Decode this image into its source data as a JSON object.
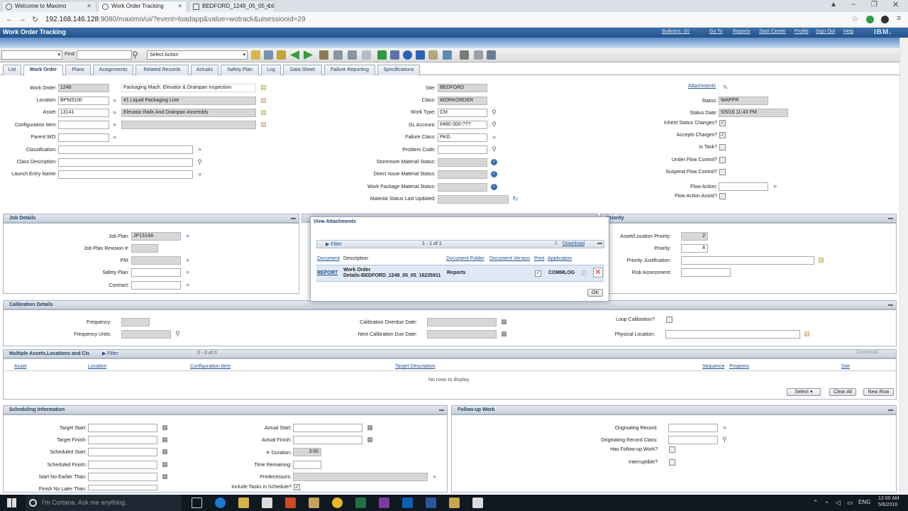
{
  "browser": {
    "tabs": [
      {
        "label": "Welcome to Maximo"
      },
      {
        "label": "Work Order Tracking"
      },
      {
        "label": "BEDFORD_1248_05_05_16"
      }
    ],
    "url_host": "192.168.146.128",
    "url_rest": ":9080/maximo/ui/?event=loadapp&value=wotrack&uisessionid=29"
  },
  "header": {
    "app_title": "Work Order Tracking",
    "links": [
      "Bulletins: (0)",
      "Go To",
      "Reports",
      "Start Center",
      "Profile",
      "Sign Out",
      "Help"
    ],
    "brand": "IBM."
  },
  "toolbar": {
    "find_label": "Find:",
    "select_action": "Select Action"
  },
  "tabs": [
    "List",
    "Work Order",
    "Plans",
    "Assignments",
    "Related Records",
    "Actuals",
    "Safety Plan",
    "Log",
    "Data Sheet",
    "Failure Reporting",
    "Specifications"
  ],
  "wo": {
    "work_order_label": "Work Order:",
    "work_order": "1248",
    "description": "Packaging Mach. Elevator & Drainpan Inspection",
    "location_label": "Location:",
    "location": "BPM3100",
    "location_desc": "#1 Liquid Packaging Line",
    "asset_label": "Asset:",
    "asset": "13141",
    "asset_desc": "Elevator Rails And Drainpan Assembly",
    "config_label": "Configuration Item:",
    "parent_label": "Parent WO:",
    "classification_label": "Classification:",
    "class_desc_label": "Class Description:",
    "launch_label": "Launch Entry Name:",
    "site_label": "Site:",
    "site": "BEDFORD",
    "class_label": "Class:",
    "class": "WORKORDER",
    "worktype_label": "Work Type:",
    "worktype": "CM",
    "gl_label": "GL Account:",
    "gl": "6480-300-???",
    "failure_label": "Failure Class:",
    "failure": "PKG",
    "problem_label": "Problem Code:",
    "storeroom_label": "Storeroom Material Status:",
    "direct_label": "Direct Issue Material Status:",
    "workpkg_label": "Work Package Material Status:",
    "matlast_label": "Material Status Last Updated:",
    "attachments_label": "Attachments",
    "status_label": "Status:",
    "status": "WAPPR",
    "status_date_label": "Status Date:",
    "status_date": "5/5/16 11:43 PM",
    "inherit_label": "Inherit Status Changes?",
    "accepts_label": "Accepts Charges?",
    "is_task_label": "Is Task?",
    "under_flow_label": "Under Flow Control?",
    "suspend_flow_label": "Suspend Flow Control?",
    "flow_action_label": "Flow Action:",
    "flow_assist_label": "Flow Action Assist?"
  },
  "job": {
    "title": "Job Details",
    "job_plan_label": "Job Plan:",
    "job_plan": "JP1314A",
    "revision_label": "Job Plan Revision #:",
    "pm_label": "PM:",
    "safety_label": "Safety Plan:",
    "contract_label": "Contract:"
  },
  "priority": {
    "title": "Priority",
    "asset_loc_label": "Asset/Location Priority:",
    "asset_loc": "2",
    "priority_label": "Priority:",
    "priority": "8",
    "justification_label": "Priority Justification:",
    "risk_label": "Risk Assessment:"
  },
  "calibration": {
    "title": "Calibration Details",
    "frequency_label": "Frequency:",
    "freq_units_label": "Frequency Units:",
    "overdue_label": "Calibration Overdue Date:",
    "next_due_label": "Next Calibration Due Date:",
    "loop_label": "Loop Calibration?",
    "physical_label": "Physical Location:"
  },
  "multi": {
    "title": "Multiple Assets,Locations and CIs",
    "filter": "Filter",
    "count": "0 - 0 of 0",
    "download": "Download",
    "cols": [
      "Asset",
      "Location",
      "Configuration Item",
      "Target Description",
      "Sequence",
      "Progress",
      "Site"
    ],
    "empty": "No rows to display.",
    "select_btn": "Select",
    "clear_btn": "Clear All",
    "new_btn": "New Row"
  },
  "scheduling": {
    "title": "Scheduling Information",
    "target_start": "Target Start:",
    "target_finish": "Target Finish:",
    "sched_start": "Scheduled Start:",
    "sched_finish": "Scheduled Finish:",
    "start_no_earlier": "Start No Earlier Than:",
    "finish_no_later": "Finish No Later Than:",
    "actual_start": "Actual Start:",
    "actual_finish": "Actual Finish:",
    "duration_label": "Duration:",
    "duration": "3:00",
    "remaining_label": "Time Remaining:",
    "predecessors_label": "Predecessors:",
    "include_tasks_label": "Include Tasks in Schedule?"
  },
  "followup": {
    "title": "Follow-up Work",
    "orig_record": "Originating Record:",
    "orig_class": "Originating Record Class:",
    "has_followup": "Has Follow-up Work?",
    "interruptible": "Interruptible?"
  },
  "dialog": {
    "title": "View Attachments",
    "filter": "Filter",
    "count": "1 - 1 of 1",
    "download": "Download",
    "cols": [
      "Document",
      "Description",
      "Document Folder",
      "Document Version",
      "Print",
      "Application"
    ],
    "row": {
      "document": "REPORT",
      "desc1": "Work Order",
      "desc2": "Details-BEDFORD_1248_05_05_16235911",
      "folder": "Reports",
      "application": "COMMLOG"
    },
    "ok": "OK"
  },
  "taskbar": {
    "cortana": "I'm Cortana. Ask me anything.",
    "lang": "ENG",
    "time": "12:00 AM",
    "date": "5/6/2016"
  }
}
